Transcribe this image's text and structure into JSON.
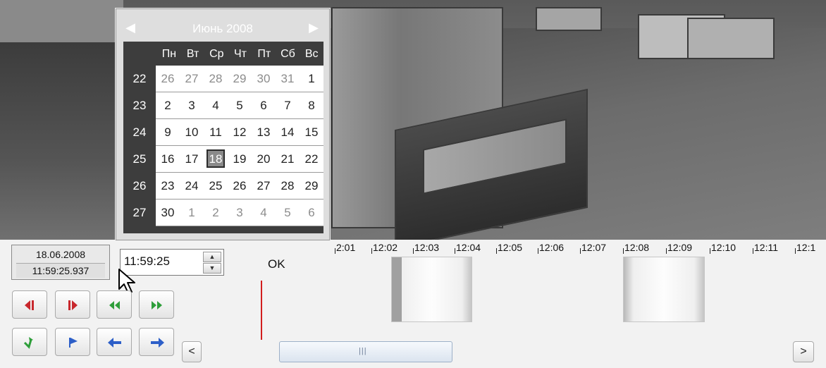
{
  "calendar": {
    "title": "Июнь 2008",
    "prev": "◀",
    "next": "▶",
    "weekdays": [
      "Пн",
      "Вт",
      "Ср",
      "Чт",
      "Пт",
      "Сб",
      "Вс"
    ],
    "weeks": [
      {
        "num": "22",
        "days": [
          "26",
          "27",
          "28",
          "29",
          "30",
          "31",
          "1"
        ]
      },
      {
        "num": "23",
        "days": [
          "2",
          "3",
          "4",
          "5",
          "6",
          "7",
          "8"
        ]
      },
      {
        "num": "24",
        "days": [
          "9",
          "10",
          "11",
          "12",
          "13",
          "14",
          "15"
        ]
      },
      {
        "num": "25",
        "days": [
          "16",
          "17",
          "18",
          "19",
          "20",
          "21",
          "22"
        ]
      },
      {
        "num": "26",
        "days": [
          "23",
          "24",
          "25",
          "26",
          "27",
          "28",
          "29"
        ]
      },
      {
        "num": "27",
        "days": [
          "30",
          "1",
          "2",
          "3",
          "4",
          "5",
          "6"
        ]
      }
    ],
    "selected_day": "18"
  },
  "controls": {
    "date": "18.06.2008",
    "time": "11:59:25.937",
    "time_input": "11:59:25",
    "ok_label": "OK",
    "scroll_left": "<",
    "scroll_right": ">",
    "scroll_grip": "|||"
  },
  "timeline": {
    "ticks": [
      "2:01",
      "12:02",
      "12:03",
      "12:04",
      "12:05",
      "12:06",
      "12:07",
      "12:08",
      "12:09",
      "12:10",
      "12:11",
      "12:1"
    ]
  },
  "icons": {
    "step_back_start": "step-back-start-icon",
    "step_forward": "step-forward-icon",
    "rewind": "rewind-icon",
    "fast_forward": "fast-forward-icon",
    "confirm": "check-icon",
    "flag": "flag-icon",
    "back": "arrow-left-icon",
    "forward": "arrow-right-icon"
  },
  "colors": {
    "red_icon": "#c8282d",
    "green_icon": "#2e9e3a",
    "blue_icon": "#2d5fc8",
    "marker": "#d21e1e"
  }
}
